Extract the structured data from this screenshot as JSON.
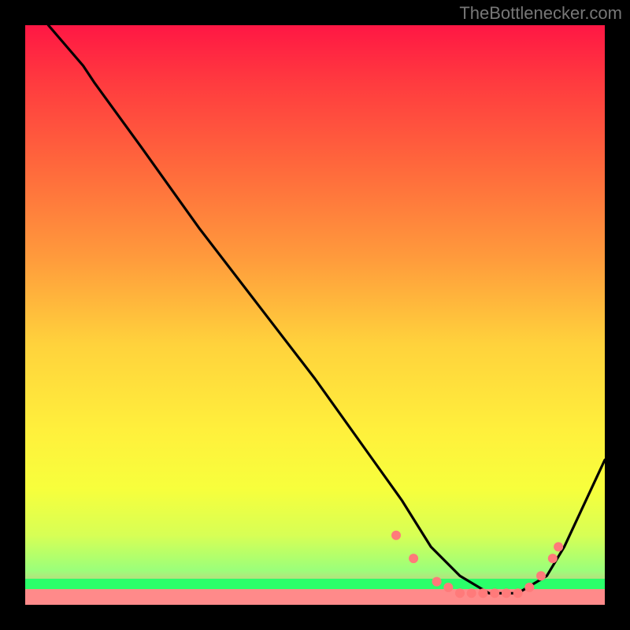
{
  "watermark": "TheBottlenecker.com",
  "chart_data": {
    "type": "line",
    "title": "",
    "xlabel": "",
    "ylabel": "",
    "xlim": [
      0,
      100
    ],
    "ylim": [
      0,
      100
    ],
    "background_gradient": {
      "stops": [
        {
          "offset": 0,
          "color": "#ff1744"
        },
        {
          "offset": 10,
          "color": "#ff3b3f"
        },
        {
          "offset": 25,
          "color": "#ff6a3c"
        },
        {
          "offset": 40,
          "color": "#ff9a3c"
        },
        {
          "offset": 55,
          "color": "#ffd23c"
        },
        {
          "offset": 70,
          "color": "#fff03c"
        },
        {
          "offset": 80,
          "color": "#f7ff3c"
        },
        {
          "offset": 88,
          "color": "#d7ff55"
        },
        {
          "offset": 94,
          "color": "#9bff7a"
        },
        {
          "offset": 100,
          "color": "#ff8a8a"
        }
      ],
      "thin_green_band_y": 96
    },
    "series": [
      {
        "name": "curve",
        "color": "#000000",
        "x": [
          4,
          10,
          12,
          20,
          30,
          40,
          50,
          60,
          65,
          70,
          75,
          80,
          85,
          90,
          93,
          100
        ],
        "y": [
          100,
          93,
          90,
          79,
          65,
          52,
          39,
          25,
          18,
          10,
          5,
          2,
          2,
          5,
          10,
          25
        ]
      }
    ],
    "markers": {
      "name": "dots",
      "color": "#ff7a7a",
      "x": [
        64,
        67,
        71,
        73,
        75,
        77,
        79,
        81,
        83,
        85,
        87,
        89,
        91,
        92
      ],
      "y": [
        12,
        8,
        4,
        3,
        2,
        2,
        2,
        2,
        2,
        2,
        3,
        5,
        8,
        10
      ]
    }
  }
}
